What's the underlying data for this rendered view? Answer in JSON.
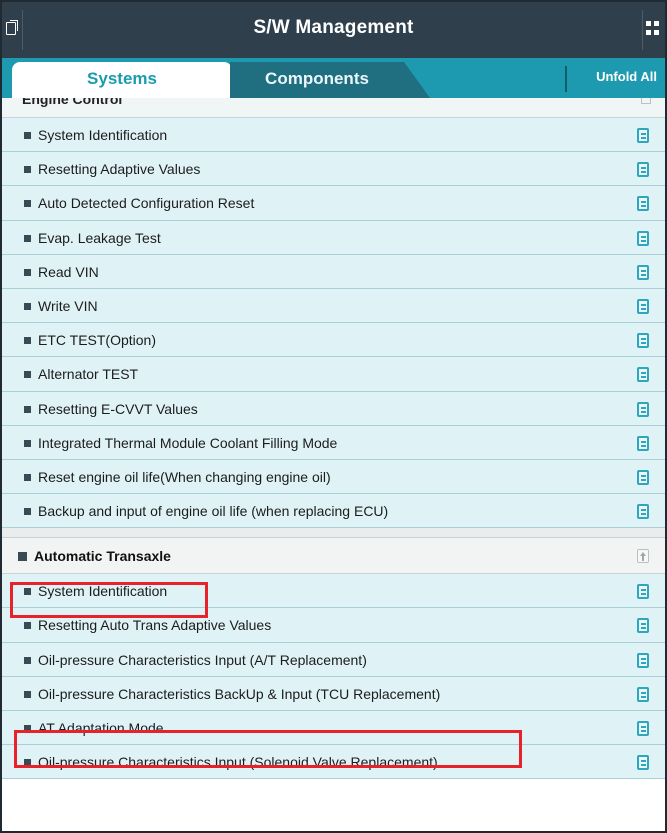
{
  "header": {
    "title": "S/W Management",
    "left_icon": "window-switch-icon",
    "right_icon": "grid-menu-icon"
  },
  "tabs": {
    "systems_label": "Systems",
    "components_label": "Components",
    "unfold_label": "Unfold All",
    "active": "Systems"
  },
  "engine_control": {
    "label": "Engine Control",
    "items": [
      {
        "label": "System Identification"
      },
      {
        "label": "Resetting Adaptive Values"
      },
      {
        "label": "Auto Detected Configuration Reset"
      },
      {
        "label": "Evap. Leakage Test"
      },
      {
        "label": "Read VIN"
      },
      {
        "label": "Write VIN"
      },
      {
        "label": "ETC TEST(Option)"
      },
      {
        "label": "Alternator TEST"
      },
      {
        "label": "Resetting E-CVVT Values"
      },
      {
        "label": "Integrated Thermal Module Coolant Filling Mode"
      },
      {
        "label": "Reset engine oil life(When changing engine oil)"
      },
      {
        "label": "Backup and input of engine oil life (when replacing ECU)"
      }
    ]
  },
  "automatic_transaxle": {
    "label": "Automatic Transaxle",
    "items": [
      {
        "label": "System Identification"
      },
      {
        "label": "Resetting Auto Trans Adaptive Values"
      },
      {
        "label": "Oil-pressure Characteristics Input (A/T Replacement)"
      },
      {
        "label": "Oil-pressure Characteristics BackUp & Input (TCU Replacement)"
      },
      {
        "label": "AT Adaptation Mode"
      },
      {
        "label": "Oil-pressure Characteristics Input (Solenoid Valve Replacement)"
      }
    ]
  },
  "colors": {
    "header_bg": "#2f3f4c",
    "tab_bar_bg": "#1d9ab0",
    "item_bg": "#dff3f7",
    "highlight": "#e8222a"
  }
}
